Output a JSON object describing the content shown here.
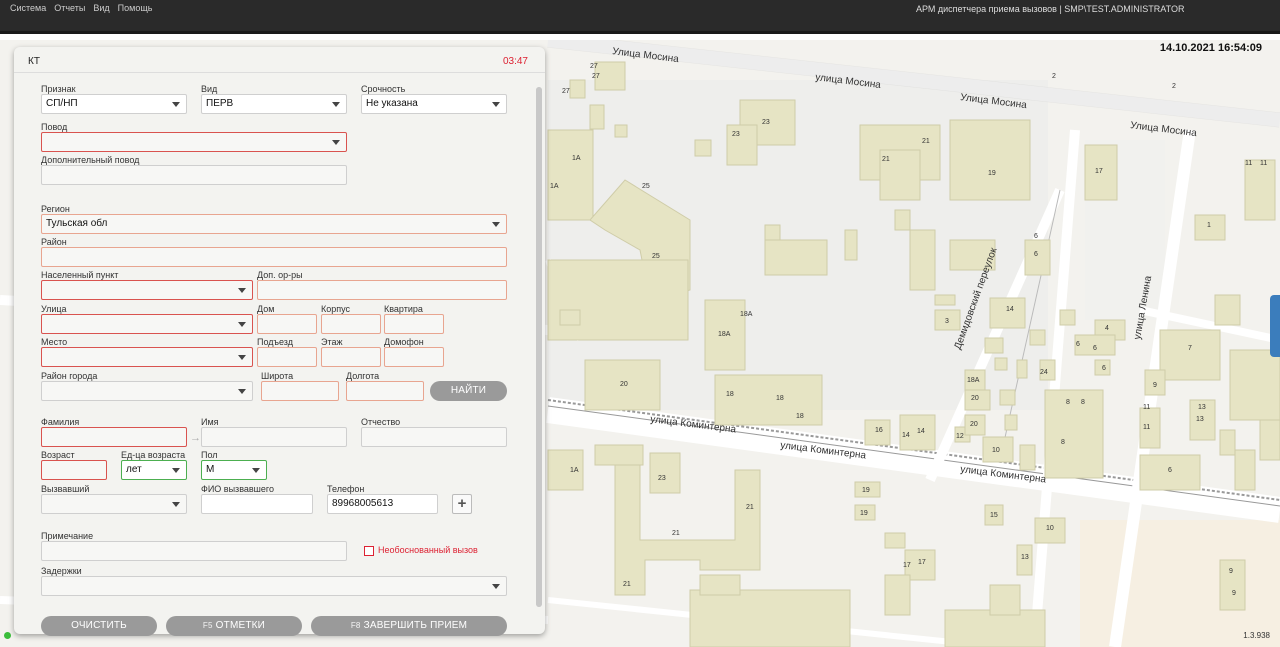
{
  "menu": [
    "Система",
    "Отчеты",
    "Вид",
    "Помощь"
  ],
  "app_title": "АРМ диспетчера приема вызовов | SMP\\TEST.ADMINISTRATOR",
  "map": {
    "datetime": "14.10.2021 16:54:09",
    "version": "1.3.938",
    "streets": [
      "Улица Мосина",
      "улица Мосина",
      "Улица Мосина",
      "Улица Мосина",
      "улица Коминтерна",
      "улица Коминтерна",
      "улица Коминтерна",
      "Демидовский переулок",
      "улица Ленина"
    ],
    "house_numbers": [
      "27",
      "27",
      "27",
      "2",
      "2",
      "23",
      "23",
      "21",
      "21",
      "19",
      "17",
      "1A",
      "1A",
      "25",
      "25",
      "11",
      "11",
      "1",
      "6",
      "6",
      "14",
      "3",
      "18A",
      "18A",
      "4",
      "6",
      "6",
      "7",
      "20",
      "18",
      "18",
      "18",
      "18A",
      "20",
      "24",
      "9",
      "8",
      "8",
      "8",
      "13",
      "13",
      "16",
      "14",
      "14",
      "12",
      "20",
      "10",
      "11",
      "11",
      "6",
      "1A",
      "23",
      "19",
      "19",
      "15",
      "10",
      "21",
      "21",
      "21",
      "17",
      "17",
      "13",
      "9",
      "9",
      "6"
    ]
  },
  "form": {
    "header": "КТ",
    "timer": "03:47",
    "labels": {
      "priznak": "Признак",
      "vid": "Вид",
      "urgency": "Срочность",
      "povod": "Повод",
      "dop_povod": "Дополнительный повод",
      "region": "Регион",
      "rayon": "Район",
      "np": "Населенный пункт",
      "dop_orry": "Доп. ор-ры",
      "street": "Улица",
      "dom": "Дом",
      "korpus": "Корпус",
      "kvartira": "Квартира",
      "mesto": "Место",
      "podezd": "Подъезд",
      "etazh": "Этаж",
      "domofon": "Домофон",
      "city_district": "Район города",
      "lat": "Широта",
      "lon": "Долгота",
      "surname": "Фамилия",
      "name": "Имя",
      "patronymic": "Отчество",
      "age": "Возраст",
      "age_unit": "Ед-ца возраста",
      "sex": "Пол",
      "caller": "Вызвавший",
      "caller_fio": "ФИО вызвавшего",
      "phone": "Телефон",
      "note": "Примечание",
      "unjustified": "Необоснованный вызов",
      "delays": "Задержки"
    },
    "values": {
      "priznak": "СП/НП",
      "vid": "ПЕРВ",
      "urgency": "Не указана",
      "region": "Тульская обл",
      "age_unit": "лет",
      "sex": "М",
      "phone": "89968005613"
    },
    "buttons": {
      "find": "НАЙТИ",
      "clear": "ОЧИСТИТЬ",
      "marks_key": "F5",
      "marks": "ОТМЕТКИ",
      "finish_key": "F8",
      "finish": "ЗАВЕРШИТЬ ПРИЕМ",
      "plus": "+"
    }
  },
  "colors": {
    "topbar": "#2a2a2a",
    "building": "#e6e4c4",
    "road": "#ffffff",
    "panel": "#f3f3f0",
    "required_border": "#d9534f",
    "ok_border": "#4caf50",
    "accent": "#3b7dbc"
  }
}
